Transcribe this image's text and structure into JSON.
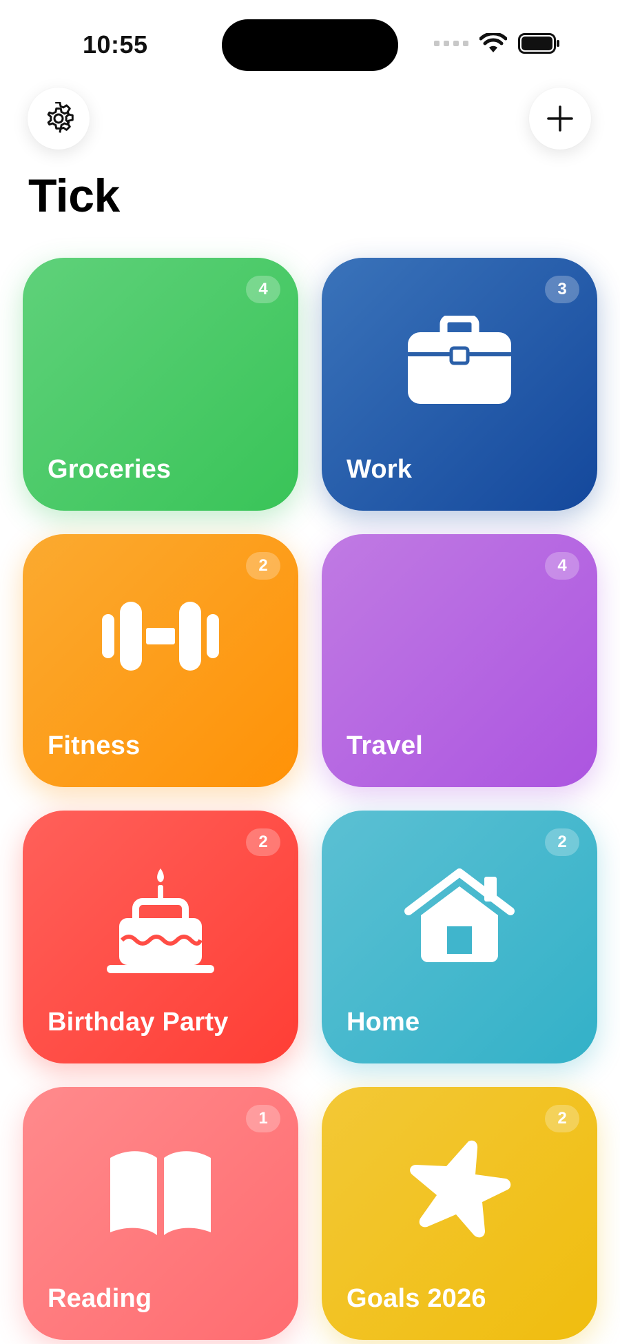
{
  "status_bar": {
    "time": "10:55"
  },
  "header": {
    "title": "Tick",
    "settings_icon": "gear-icon",
    "add_icon": "plus-icon"
  },
  "lists": [
    {
      "name": "Groceries",
      "count": "4",
      "icon": "none",
      "color": "#39c458"
    },
    {
      "name": "Work",
      "count": "3",
      "icon": "briefcase-icon",
      "color": "#14489c"
    },
    {
      "name": "Fitness",
      "count": "2",
      "icon": "dumbbell-icon",
      "color": "#ff9207"
    },
    {
      "name": "Travel",
      "count": "4",
      "icon": "none",
      "color": "#ac55e0"
    },
    {
      "name": "Birthday Party",
      "count": "2",
      "icon": "cake-icon",
      "color": "#ff3e35"
    },
    {
      "name": "Home",
      "count": "2",
      "icon": "house-icon",
      "color": "#33b1c8"
    },
    {
      "name": "Reading",
      "count": "1",
      "icon": "book-icon",
      "color": "#ff6c70"
    },
    {
      "name": "Goals 2026",
      "count": "2",
      "icon": "star-icon",
      "color": "#f0bd0f"
    }
  ]
}
